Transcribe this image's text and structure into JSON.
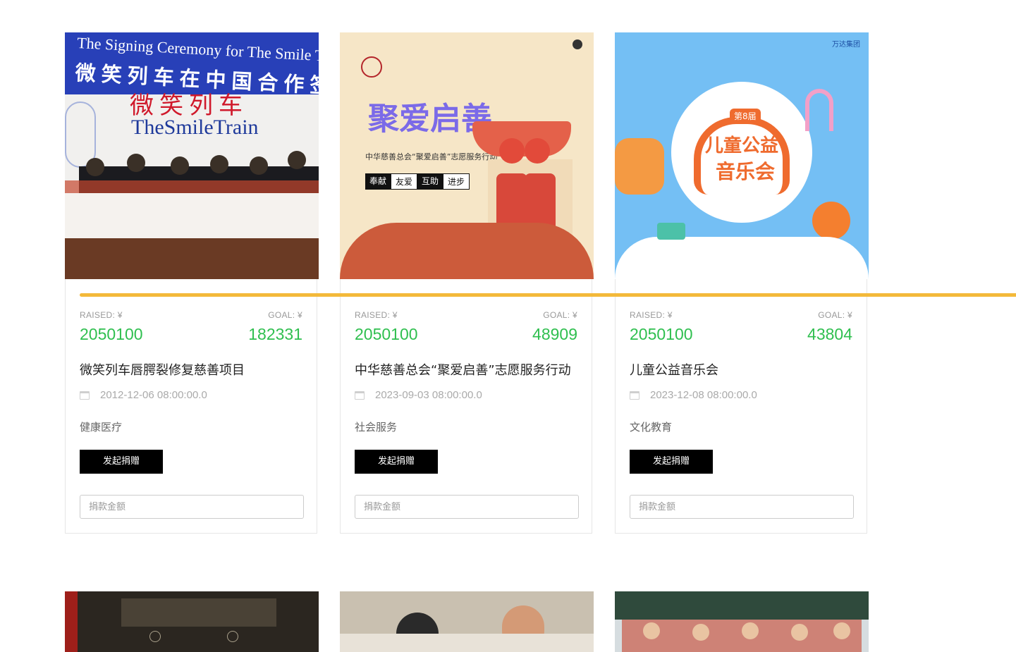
{
  "cards": [
    {
      "image_alt": "",
      "img_heading_en": "The Signing Ceremony for The Smile Tr",
      "img_heading_cn": "微笑列车在中国合作签",
      "img_logo_cn": "微笑列车",
      "img_logo_en": "TheSmileTrain",
      "raised_label": "RAISED: ¥",
      "raised_value": "2050100",
      "goal_label": "GOAL: ¥",
      "goal_value": "182331",
      "title": "微笑列车唇腭裂修复慈善项目",
      "date": "2012-12-06 08:00:00.0",
      "category": "健康医疗",
      "button_label": "发起捐赠",
      "input_placeholder": "捐款金额"
    },
    {
      "image_alt": "",
      "img_headline": "聚爱启善",
      "img_subtitle": "中华慈善总会“聚爱启善”志愿服务行动",
      "img_tags": [
        "奉献",
        "友爱",
        "互助",
        "进步"
      ],
      "raised_label": "RAISED: ¥",
      "raised_value": "2050100",
      "goal_label": "GOAL: ¥",
      "goal_value": "48909",
      "title": "中华慈善总会“聚爱启善”志愿服务行动",
      "date": "2023-09-03 08:00:00.0",
      "category": "社会服务",
      "button_label": "发起捐赠",
      "input_placeholder": "捐款金额"
    },
    {
      "image_alt": "",
      "img_badge": "第8届",
      "img_headline1": "儿童公益",
      "img_headline2": "音乐会",
      "img_brand": "万达集团",
      "raised_label": "RAISED: ¥",
      "raised_value": "2050100",
      "goal_label": "GOAL: ¥",
      "goal_value": "43804",
      "title": "儿童公益音乐会",
      "date": "2023-12-08 08:00:00.0",
      "category": "文化教育",
      "button_label": "发起捐赠",
      "input_placeholder": "捐款金额"
    }
  ],
  "colors": {
    "accent_green": "#2fbf4f",
    "progress_yellow": "#f3b93a",
    "button_black": "#000000"
  }
}
